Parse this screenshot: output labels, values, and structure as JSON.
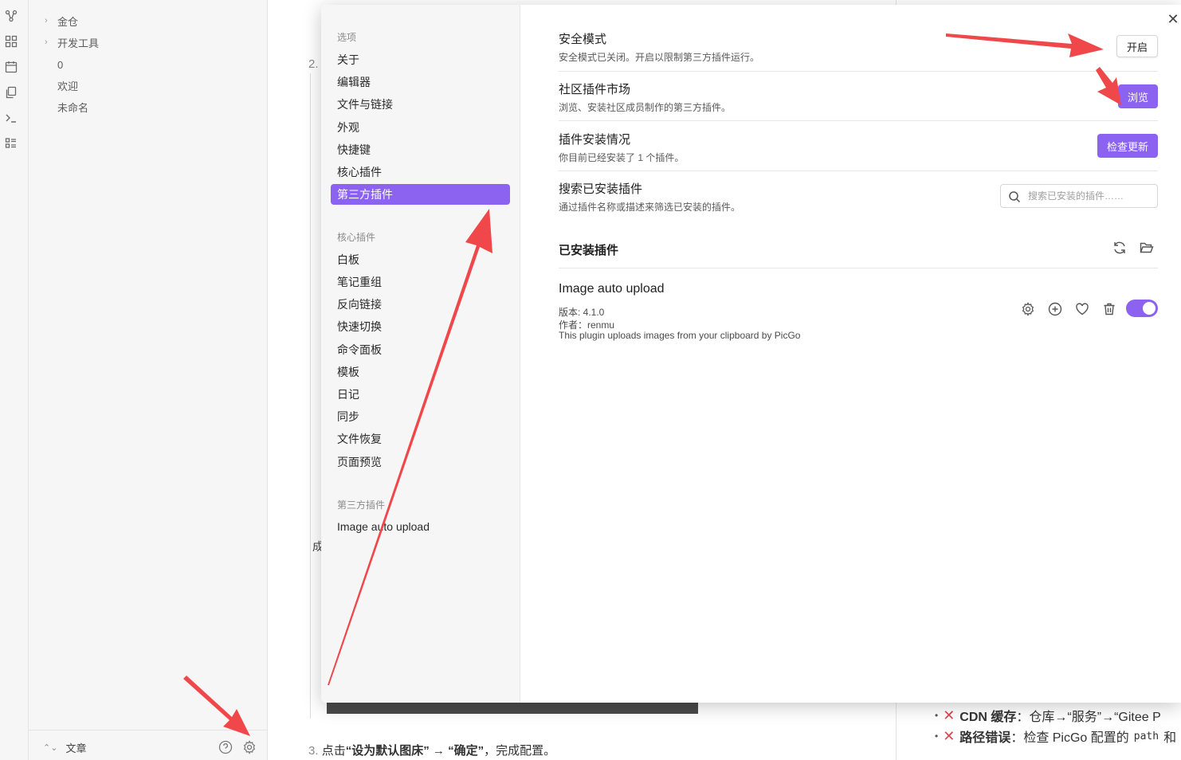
{
  "sidebar": {
    "tree": [
      {
        "label": "金仓",
        "folder": true
      },
      {
        "label": "开发工具",
        "folder": true
      },
      {
        "label": "0",
        "folder": false
      },
      {
        "label": "欢迎",
        "folder": false
      },
      {
        "label": "未命名",
        "folder": false
      }
    ],
    "vault_name": "文章"
  },
  "editor": {
    "step2_num": "2.",
    "fragment": "成",
    "step3": {
      "num": "3.",
      "pre": "点击",
      "b1": "“设为默认图床”",
      "arrow": " → ",
      "b2": "“确定”",
      "post": "，完成配置。"
    }
  },
  "right_pane": {
    "items": [
      {
        "bold": "CDN 缓存",
        "text": "：仓库→“服务”→“Gitee P"
      },
      {
        "bold": "路径错误",
        "text": "：检查 PicGo 配置的",
        "code": "path",
        "tail": "和"
      }
    ]
  },
  "settings_modal": {
    "nav": {
      "options_header": "选项",
      "options": [
        "关于",
        "编辑器",
        "文件与链接",
        "外观",
        "快捷键",
        "核心插件",
        "第三方插件"
      ],
      "active_index": 6,
      "core_header": "核心插件",
      "core_plugins": [
        "白板",
        "笔记重组",
        "反向链接",
        "快速切换",
        "命令面板",
        "模板",
        "日记",
        "同步",
        "文件恢复",
        "页面预览"
      ],
      "third_header": "第三方插件",
      "third_plugins": [
        "Image auto upload"
      ]
    },
    "safe_mode": {
      "name": "安全模式",
      "desc": "安全模式已关闭。开启以限制第三方插件运行。",
      "button": "开启"
    },
    "community": {
      "name": "社区插件市场",
      "desc": "浏览、安装社区成员制作的第三方插件。",
      "button": "浏览"
    },
    "install_status": {
      "name": "插件安装情况",
      "desc": "你目前已经安装了 1 个插件。",
      "button": "检查更新"
    },
    "search_installed": {
      "name": "搜索已安装插件",
      "desc": "通过插件名称或描述来筛选已安装的插件。",
      "placeholder": "搜索已安装的插件……"
    },
    "installed_header": "已安装插件",
    "plugin": {
      "name": "Image auto upload",
      "version": "版本: 4.1.0",
      "author": "作者：renmu",
      "description": "This plugin uploads images from your clipboard by PicGo",
      "enabled": true
    },
    "accent_color": "#8b63f0"
  },
  "annotation_color": "#f0474a"
}
